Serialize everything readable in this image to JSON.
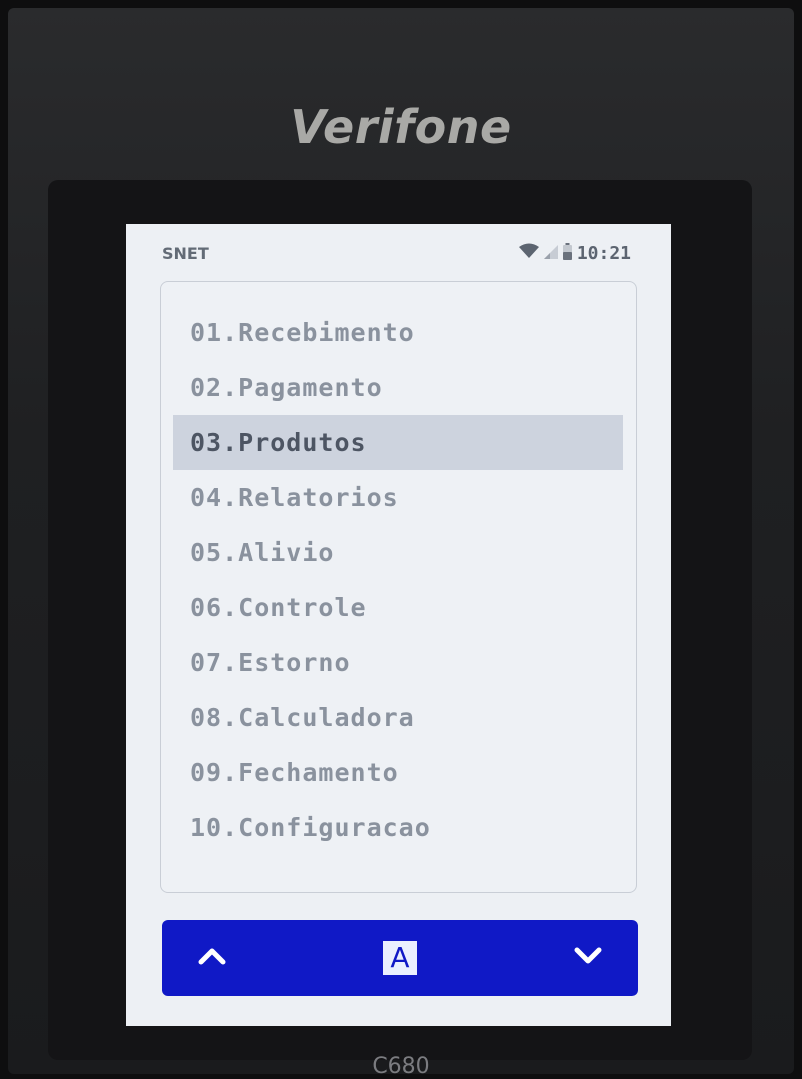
{
  "device": {
    "brand": "Verifone",
    "model": "C680"
  },
  "status_bar": {
    "carrier": "SNET",
    "time": "10:21",
    "icons": [
      "wifi-icon",
      "signal-icon",
      "battery-icon"
    ]
  },
  "menu": {
    "items": [
      {
        "label": "01.Recebimento"
      },
      {
        "label": "02.Pagamento"
      },
      {
        "label": "03.Produtos"
      },
      {
        "label": "04.Relatorios"
      },
      {
        "label": "05.Alivio"
      },
      {
        "label": "06.Controle"
      },
      {
        "label": "07.Estorno"
      },
      {
        "label": "08.Calculadora"
      },
      {
        "label": "09.Fechamento"
      },
      {
        "label": "10.Configuracao"
      }
    ],
    "selected_index": 2
  },
  "nav_bar": {
    "up_icon": "chevron-up-icon",
    "keyboard_key_label": "A",
    "down_icon": "chevron-down-icon"
  },
  "colors": {
    "nav_background": "#1019c6",
    "screen_background": "#edf0f4",
    "selected_item_background": "#cdd3de"
  }
}
